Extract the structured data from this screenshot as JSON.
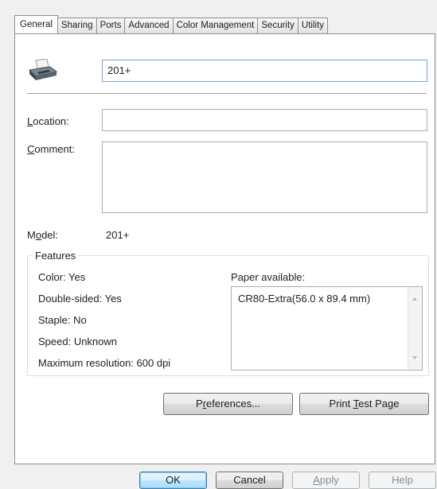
{
  "tabs": [
    "General",
    "Sharing",
    "Ports",
    "Advanced",
    "Color Management",
    "Security",
    "Utility"
  ],
  "printer": {
    "name_value": "201+"
  },
  "location": {
    "label_pre": "",
    "label_key": "L",
    "label_post": "ocation:",
    "value": ""
  },
  "comment": {
    "label_pre": "",
    "label_key": "C",
    "label_post": "omment:",
    "value": ""
  },
  "model": {
    "label_pre": "M",
    "label_key": "o",
    "label_post": "del:",
    "value": "201+"
  },
  "features": {
    "title": "Features",
    "color": "Color: Yes",
    "double_sided": "Double-sided: Yes",
    "staple": "Staple: No",
    "speed": "Speed: Unknown",
    "max_res": "Maximum resolution: 600 dpi",
    "paper_label": "Paper available:",
    "paper_items": [
      "CR80-Extra(56.0 x 89.4 mm)"
    ]
  },
  "buttons": {
    "pref_pre": "P",
    "pref_key": "r",
    "pref_post": "eferences...",
    "test_pre": "Print ",
    "test_key": "T",
    "test_post": "est Page",
    "ok": "OK",
    "cancel": "Cancel",
    "apply_key": "A",
    "apply_post": "pply",
    "help": "Help"
  }
}
